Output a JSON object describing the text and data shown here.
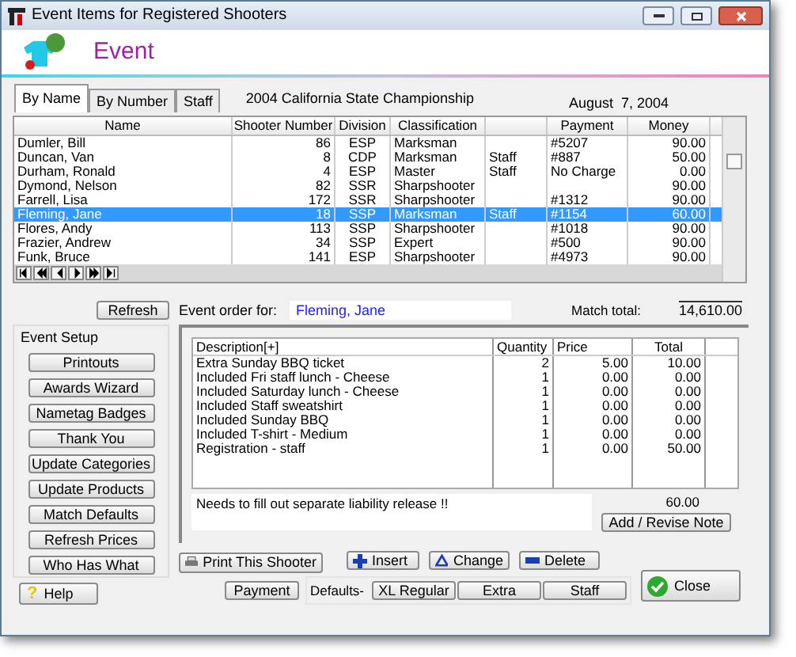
{
  "window": {
    "title": "Event Items for Registered Shooters"
  },
  "header": {
    "title": "Event"
  },
  "tabs": [
    {
      "label": "By Name",
      "selected": true
    },
    {
      "label": "By Number",
      "selected": false
    },
    {
      "label": "Staff",
      "selected": false
    }
  ],
  "event_name": "2004 California State Championship",
  "event_date": "August  7, 2004",
  "shooters": {
    "columns": [
      "Name",
      "Shooter Number",
      "Division",
      "Classification",
      "",
      "Payment",
      "Money"
    ],
    "rows": [
      {
        "cells": [
          "Dumler, Bill",
          "86",
          "ESP",
          "Marksman",
          "",
          "#5207",
          "90.00"
        ],
        "selected": false
      },
      {
        "cells": [
          "Duncan, Van",
          "8",
          "CDP",
          "Marksman",
          "Staff",
          "#887",
          "50.00"
        ],
        "selected": false
      },
      {
        "cells": [
          "Durham, Ronald",
          "4",
          "ESP",
          "Master",
          "Staff",
          "No Charge",
          "0.00"
        ],
        "selected": false
      },
      {
        "cells": [
          "Dymond, Nelson",
          "82",
          "SSR",
          "Sharpshooter",
          "",
          "",
          "90.00"
        ],
        "selected": false
      },
      {
        "cells": [
          "Farrell, Lisa",
          "172",
          "SSR",
          "Sharpshooter",
          "",
          "#1312",
          "90.00"
        ],
        "selected": false
      },
      {
        "cells": [
          "Fleming, Jane",
          "18",
          "SSP",
          "Marksman",
          "Staff",
          "#1154",
          "60.00"
        ],
        "selected": true
      },
      {
        "cells": [
          "Flores, Andy",
          "113",
          "SSP",
          "Sharpshooter",
          "",
          "#1018",
          "90.00"
        ],
        "selected": false
      },
      {
        "cells": [
          "Frazier, Andrew",
          "34",
          "SSP",
          "Expert",
          "",
          "#500",
          "90.00"
        ],
        "selected": false
      },
      {
        "cells": [
          "Funk, Bruce",
          "141",
          "ESP",
          "Sharpshooter",
          "",
          "#4973",
          "90.00"
        ],
        "selected": false
      }
    ]
  },
  "refresh_button": "Refresh",
  "order_label": "Event order for:",
  "order_name": "Fleming, Jane",
  "match_total_label": "Match total:",
  "match_total": "14,610.00",
  "event_setup": {
    "title": "Event Setup",
    "buttons": [
      "Printouts",
      "Awards Wizard",
      "Nametag Badges",
      "Thank You",
      "Update Categories",
      "Update Products",
      "Match Defaults",
      "Refresh Prices",
      "Who Has What"
    ]
  },
  "help_button": "Help",
  "help_icon": "?",
  "items": {
    "columns": [
      "Description[+]",
      "Quantity",
      "Price",
      "Total"
    ],
    "rows": [
      [
        "Extra Sunday BBQ ticket",
        "2",
        "5.00",
        "10.00"
      ],
      [
        "Included Fri staff lunch - Cheese",
        "1",
        "0.00",
        "0.00"
      ],
      [
        "Included Saturday lunch - Cheese",
        "1",
        "0.00",
        "0.00"
      ],
      [
        "Included Staff sweatshirt",
        "1",
        "0.00",
        "0.00"
      ],
      [
        "Included Sunday BBQ",
        "1",
        "0.00",
        "0.00"
      ],
      [
        "Included T-shirt - Medium",
        "1",
        "0.00",
        "0.00"
      ],
      [
        "Registration - staff",
        "1",
        "0.00",
        "50.00"
      ]
    ]
  },
  "note": "Needs to fill out separate liability release !!",
  "order_total": "60.00",
  "note_button": "Add / Revise Note",
  "print_button": "Print This Shooter",
  "edit_buttons": [
    "Insert",
    "Change",
    "Delete"
  ],
  "payment_button": "Payment",
  "defaults_label": "Defaults-",
  "default_buttons": [
    "XL Regular",
    "Extra",
    "Staff"
  ],
  "close_button": "Close"
}
